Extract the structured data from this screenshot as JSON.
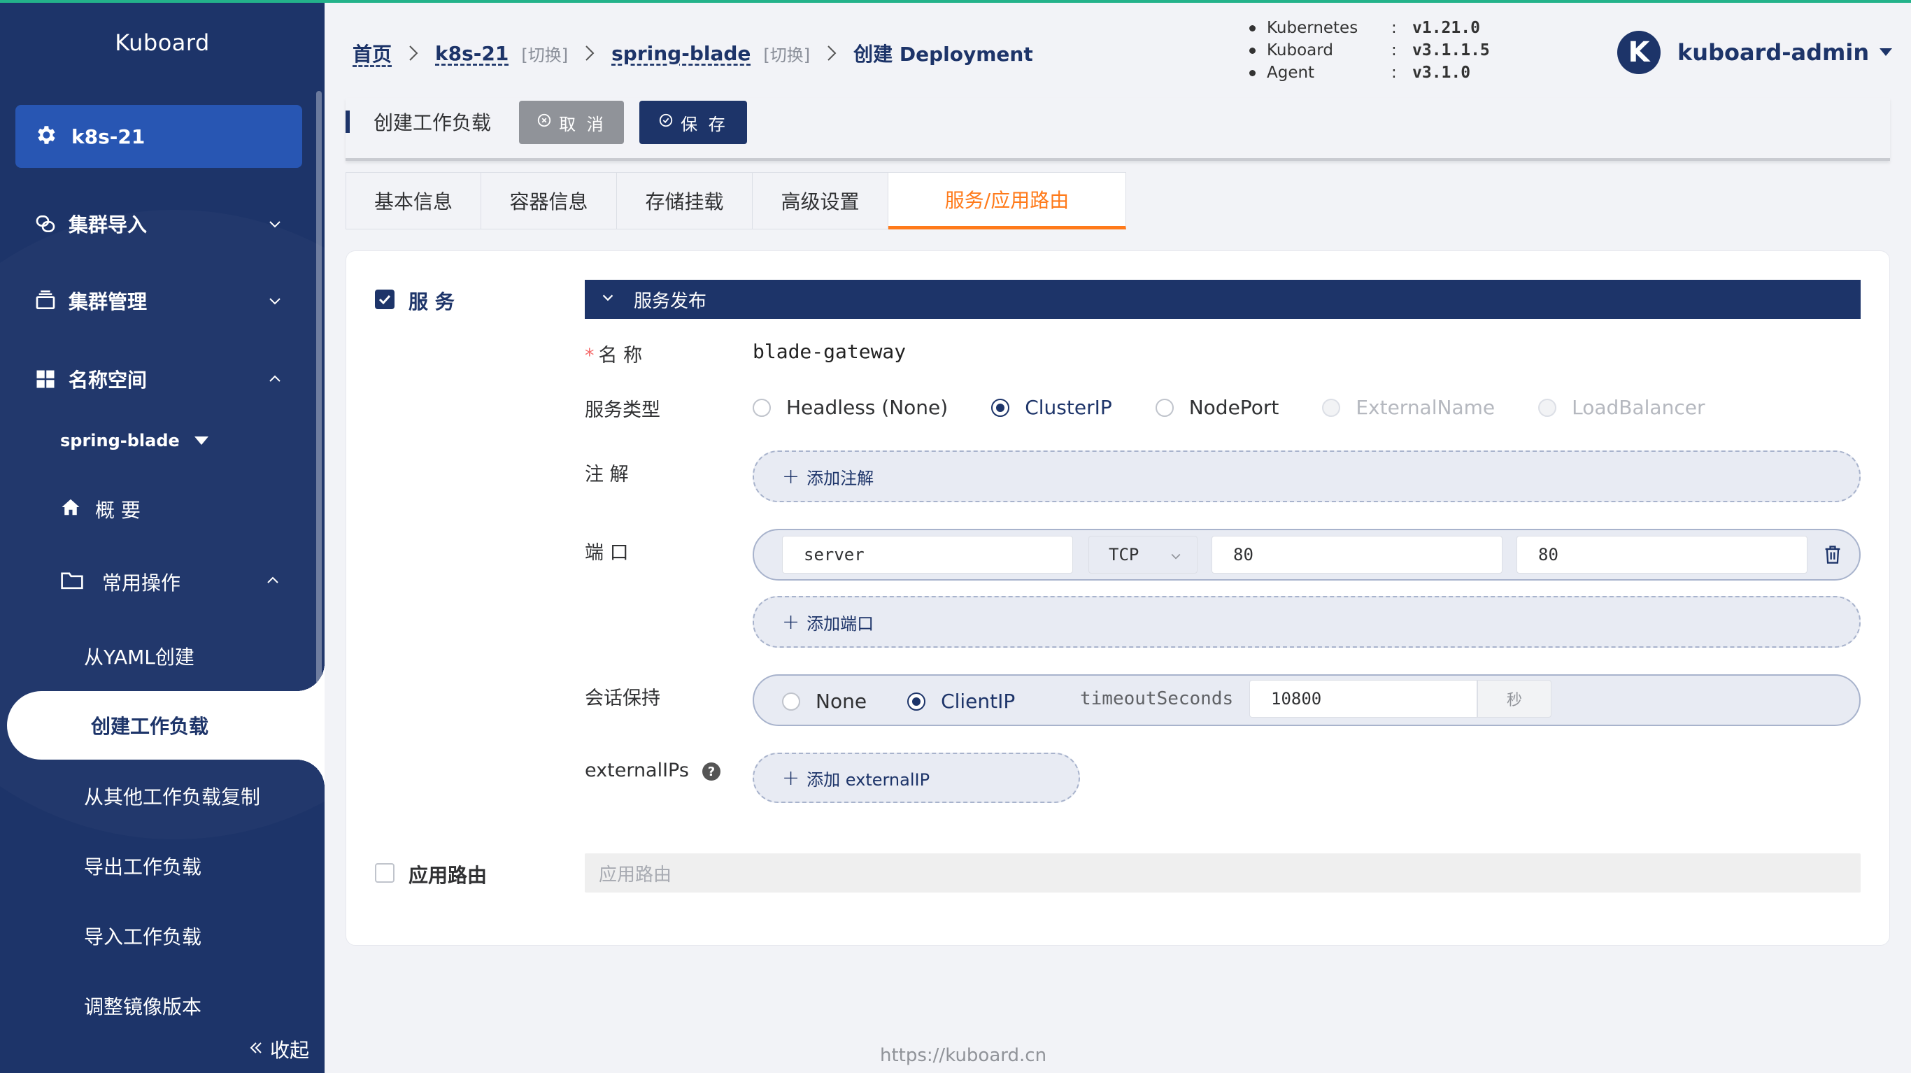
{
  "sidebar": {
    "brand": "Kuboard",
    "cluster": "k8s-21",
    "items": [
      {
        "label": "集群导入"
      },
      {
        "label": "集群管理"
      },
      {
        "label": "名称空间"
      }
    ],
    "namespace": "spring-blade",
    "overview": "概 要",
    "common_ops": "常用操作",
    "sub_items": [
      "从YAML创建",
      "创建工作负载",
      "从其他工作负载复制",
      "导出工作负载",
      "导入工作负载",
      "调整镜像版本"
    ],
    "collapse": "收起"
  },
  "breadcrumb": {
    "home": "首页",
    "cluster": "k8s-21",
    "cluster_switch": "[切换]",
    "namespace": "spring-blade",
    "namespace_switch": "[切换]",
    "current": "创建 Deployment"
  },
  "versions": [
    {
      "name": "Kubernetes",
      "colon": ":",
      "value": "v1.21.0"
    },
    {
      "name": "Kuboard",
      "colon": ":",
      "value": "v3.1.1.5"
    },
    {
      "name": "Agent",
      "colon": ":",
      "value": "v3.1.0"
    }
  ],
  "user": {
    "initial": "K",
    "name": "kuboard-admin"
  },
  "toolbar": {
    "title": "创建工作负载",
    "cancel": "取 消",
    "save": "保 存"
  },
  "tabs": [
    "基本信息",
    "容器信息",
    "存储挂载",
    "高级设置",
    "服务/应用路由"
  ],
  "service": {
    "checkbox_label": "服 务",
    "section_title": "服务发布",
    "name_label": "名 称",
    "name_value": "blade-gateway",
    "type_label": "服务类型",
    "types": [
      "Headless (None)",
      "ClusterIP",
      "NodePort",
      "ExternalName",
      "LoadBalancer"
    ],
    "selected_type": "ClusterIP",
    "annotation_label": "注 解",
    "add_annotation": "添加注解",
    "port_label": "端 口",
    "port": {
      "name": "server",
      "protocol": "TCP",
      "port": "80",
      "target_port": "80"
    },
    "add_port": "添加端口",
    "session_label": "会话保持",
    "session_options": [
      "None",
      "ClientIP"
    ],
    "selected_session": "ClientIP",
    "timeout_label": "timeoutSeconds",
    "timeout_value": "10800",
    "timeout_unit": "秒",
    "external_ips_label": "externalIPs",
    "help": "?",
    "add_external_ip": "添加 externalIP"
  },
  "route": {
    "checkbox_label": "应用路由",
    "placeholder": "应用路由"
  },
  "footer": "https://kuboard.cn",
  "colors": {
    "primary": "#1d3469",
    "accent": "#ff7a1a",
    "top_line": "#23b28a"
  }
}
